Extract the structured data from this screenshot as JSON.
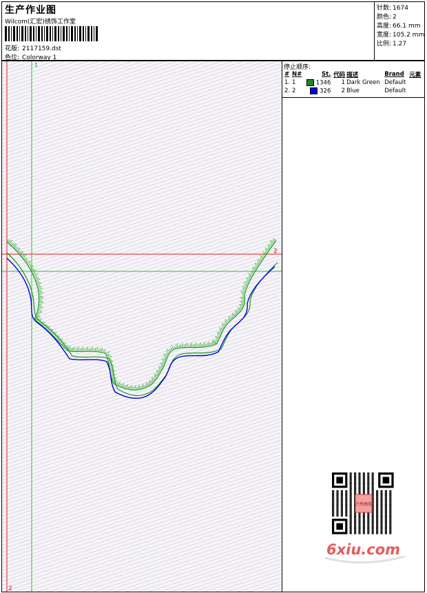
{
  "header": {
    "title": "生产作业图",
    "company": "Wilcom(汇宏)绣饰工作室",
    "design_label": "花版:",
    "design_value": "2117159.dst",
    "colorway_label": "色位:",
    "colorway_value": "Colorway 1"
  },
  "stats": [
    {
      "label": "针数:",
      "value": "1674"
    },
    {
      "label": "颜色:",
      "value": "2"
    },
    {
      "label": "高度:",
      "value": "66.1 mm"
    },
    {
      "label": "宽度:",
      "value": "105.2 mm"
    },
    {
      "label": "比例:",
      "value": "1.27"
    }
  ],
  "stop_sequence": {
    "title": "停止顺序:",
    "columns": [
      "#",
      "N#",
      "St.",
      "代码",
      "描述",
      "Brand",
      "元素"
    ],
    "rows": [
      {
        "index": "1.",
        "n": "1",
        "color": "#1a8a1a",
        "stitches": "1346",
        "code": "1",
        "description": "Dark Green",
        "brand": "Default",
        "element": ""
      },
      {
        "index": "2.",
        "n": "2",
        "color": "#0000e0",
        "stitches": "326",
        "code": "2",
        "description": "Blue",
        "brand": "Default",
        "element": ""
      }
    ]
  },
  "canvas": {
    "guide_top_label": "1",
    "guide_right_label": "2",
    "guide_bottom_label": "2",
    "guide_green": "#22cc22",
    "guide_red": "#e02020"
  },
  "watermark": {
    "text": "6xiu.com",
    "qr_center_text": "六秀图库",
    "color": "#ea5a5a"
  }
}
